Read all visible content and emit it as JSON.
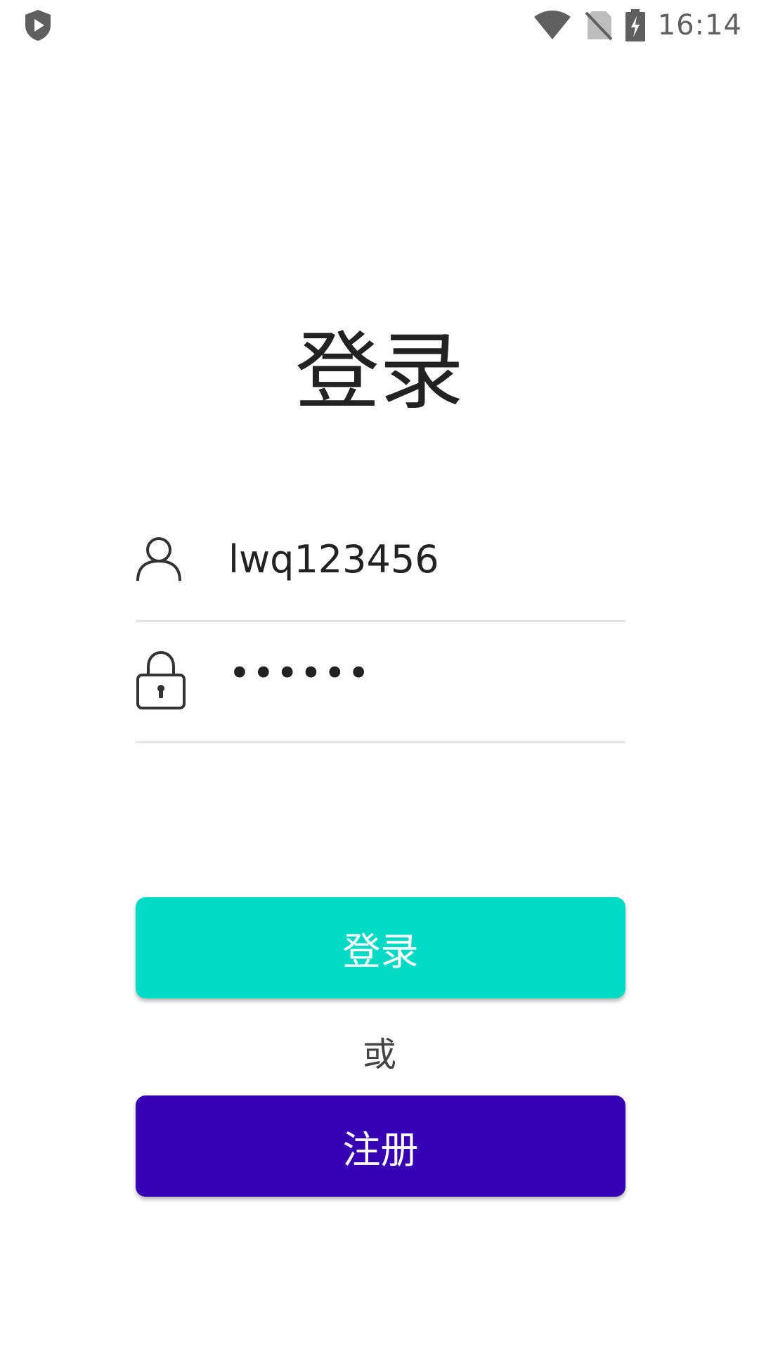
{
  "status_bar": {
    "left_icon": "shield-play-icon",
    "icons": [
      "wifi-icon",
      "no-sim-icon",
      "battery-charging-icon"
    ],
    "time": "16:14"
  },
  "title": "登录",
  "form": {
    "username": {
      "icon": "user-icon",
      "value": "lwq123456"
    },
    "password": {
      "icon": "lock-icon",
      "value": "••••••"
    }
  },
  "buttons": {
    "login_label": "登录",
    "or_text": "或",
    "register_label": "注册"
  },
  "colors": {
    "login_button": "#03dac5",
    "register_button": "#3700b3",
    "text": "#222222",
    "divider": "#e4e4e4"
  }
}
